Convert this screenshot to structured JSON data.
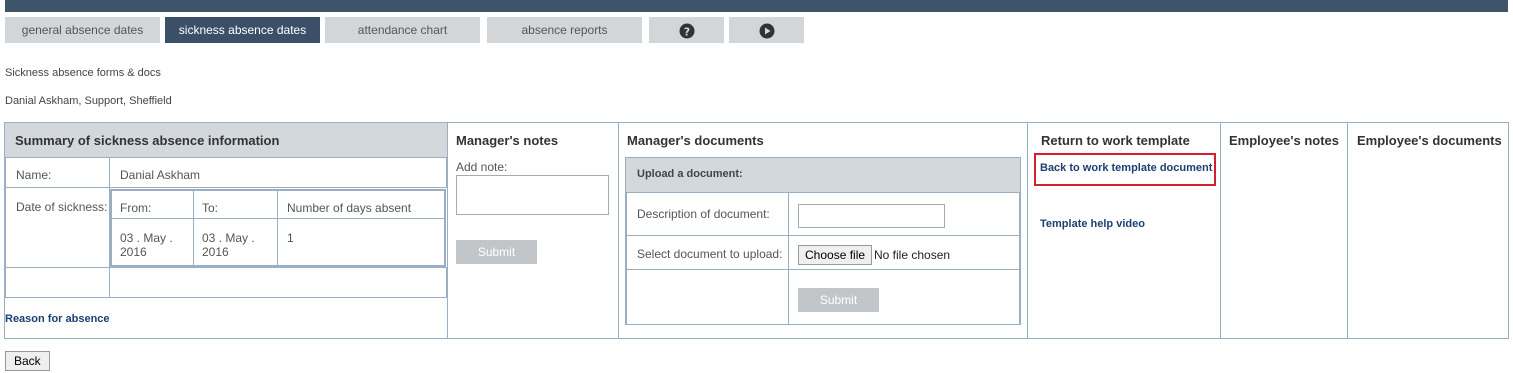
{
  "tabs": {
    "general": "general absence dates",
    "sickness": "sickness absence dates",
    "attendance": "attendance chart",
    "reports": "absence reports",
    "help_icon": "question-circle-icon",
    "play_icon": "play-circle-icon"
  },
  "page": {
    "subtitle": "Sickness absence forms & docs",
    "employee": "Danial Askham, Support, Sheffield"
  },
  "summary": {
    "title": "Summary of sickness absence information",
    "name_label": "Name:",
    "name_value": "Danial Askham",
    "date_label": "Date of sickness:",
    "from_label": "From:",
    "to_label": "To:",
    "days_label": "Number of days absent",
    "from_value": "03 . May . 2016",
    "to_value": "03 . May . 2016",
    "days_value": "1",
    "reason_link": "Reason for absence"
  },
  "manager_notes": {
    "title": "Manager's notes",
    "add_note_label": "Add note:",
    "submit": "Submit"
  },
  "manager_docs": {
    "title": "Manager's documents",
    "upload_title": "Upload a document:",
    "description_label": "Description of document:",
    "select_label": "Select document to upload:",
    "choose_file": "Choose file",
    "no_file": "No file chosen",
    "submit": "Submit"
  },
  "rtw": {
    "title": "Return to work template",
    "template_link": "Back to work template document",
    "help_video": "Template help video"
  },
  "employee_notes": {
    "title": "Employee's notes"
  },
  "employee_docs": {
    "title": "Employee's documents"
  },
  "back_button": "Back"
}
